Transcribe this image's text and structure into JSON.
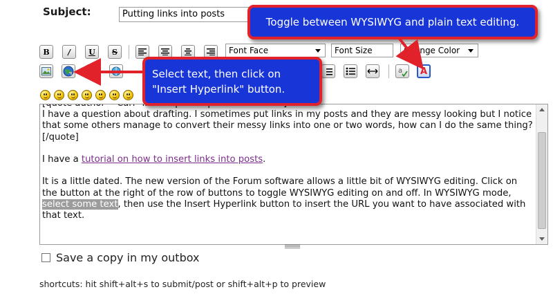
{
  "subject": {
    "label": "Subject:",
    "value": "Putting links into posts"
  },
  "toolbar": {
    "buttons": [
      {
        "name": "bold-button",
        "glyph": "B"
      },
      {
        "name": "italic-button",
        "glyph": "/"
      },
      {
        "name": "underline-button",
        "glyph": "U"
      },
      {
        "name": "strikethrough-button",
        "glyph": "S"
      }
    ],
    "font_face": "Font Face",
    "font_size": "Font Size",
    "font_color": "Change Color"
  },
  "callouts": {
    "toggle": "Toggle between WYSIWYG and plain text editing.",
    "hyperlink_line1": "Select text, then click on",
    "hyperlink_line2": "\"Insert Hyperlink\" button."
  },
  "editor": {
    "top_partial": "[quote author=\"Carl\" link=topic=... post=... date=...]",
    "line1": "I have a question about drafting. I sometimes put links in my posts and they are messy looking but I notice that some others manage to convert their messy links into one or two words, how can I do the same thing?",
    "line2": "[/quote]",
    "para2_before": "I have a ",
    "para2_link": "tutorial on how to insert links into posts",
    "para2_after": ".",
    "para3_before": "It is a little dated.  The new version of the Forum software allows a little bit of WYSIWYG editing.  Click on the button at the right of the row of buttons to toggle WYSIWYG editing on and off.  In WYSIWYG mode, ",
    "para3_selected": "select some text",
    "para3_after": ", then use the Insert Hyperlink button to insert the URL you want to have associated with that text."
  },
  "outbox": {
    "label": "Save a copy in my outbox",
    "checked": false
  },
  "shortcuts": "shortcuts: hit shift+alt+s to submit/post or shift+alt+p to preview",
  "colors": {
    "callout_fill": "#1836d8",
    "callout_border": "#e1222b",
    "arrow": "#e1222b",
    "link": "#7b2d8b",
    "selection": "#9c9c9c"
  }
}
